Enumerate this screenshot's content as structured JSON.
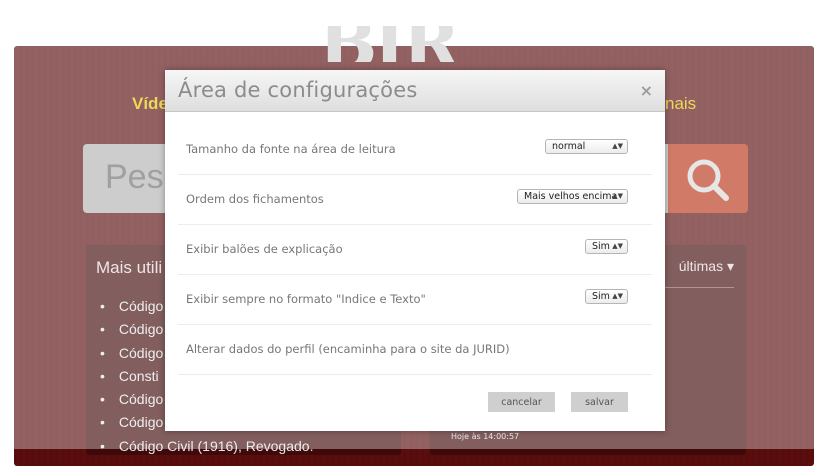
{
  "background": {
    "nav_left": "Víde",
    "nav_right": "nais",
    "search_placeholder": "Pesq",
    "most_used_title": "Mais utili",
    "most_used_items": [
      "Código",
      "Código",
      "Código",
      "Consti",
      "Código",
      "Código",
      "Código Civil (1916), Revogado."
    ],
    "latest_title": "últimas ▾",
    "timestamp": "Hoje às 14:00:57"
  },
  "modal": {
    "title": "Área de configurações",
    "close": "×",
    "rows": [
      {
        "label": "Tamanho da fonte na área de leitura",
        "value": "normal"
      },
      {
        "label": "Ordem dos fichamentos",
        "value": "Mais velhos encima"
      },
      {
        "label": "Exibir balões de explicação",
        "value": "Sim"
      },
      {
        "label": "Exibir sempre no formato \"Indice e Texto\"",
        "value": "Sim"
      },
      {
        "label": "Alterar dados do perfil (encaminha para o site da JURID)"
      }
    ],
    "cancel_label": "cancelar",
    "save_label": "salvar"
  },
  "colors": {
    "site_bg": "#5a0d0d",
    "accent_yellow": "#e2c300",
    "search_button": "#b83318"
  }
}
